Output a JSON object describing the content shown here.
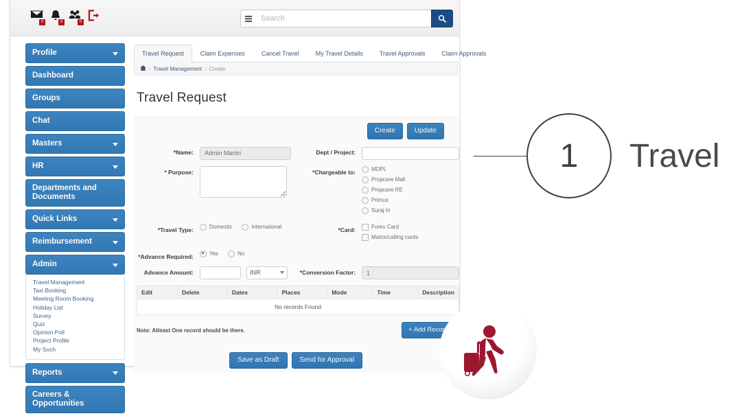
{
  "topbar": {
    "icons": [
      {
        "name": "mail-icon",
        "badge": "0"
      },
      {
        "name": "bell-icon",
        "badge": "0"
      },
      {
        "name": "users-icon",
        "badge": "0"
      },
      {
        "name": "logout-icon",
        "badge": ""
      }
    ],
    "search": {
      "placeholder": "Search",
      "value": "",
      "menu_icon": "hamburger-icon",
      "button_icon": "search-icon"
    }
  },
  "sidebar": {
    "items": [
      {
        "label": "Profile",
        "caret": true
      },
      {
        "label": "Dashboard",
        "caret": false
      },
      {
        "label": "Groups",
        "caret": false
      },
      {
        "label": "Chat",
        "caret": false
      },
      {
        "label": "Masters",
        "caret": true
      },
      {
        "label": "HR",
        "caret": true
      },
      {
        "label": "Departments and Documents",
        "caret": false
      },
      {
        "label": "Quick Links",
        "caret": true
      },
      {
        "label": "Reimbursement",
        "caret": true
      },
      {
        "label": "Admin",
        "caret": true
      }
    ],
    "admin_submenu": [
      "Travel Management",
      "Taxi Booking",
      "Meeting Room Booking",
      "Holiday List",
      "Survey",
      "Quiz",
      "Opinion Poll",
      "Project Profile",
      "My Soch"
    ],
    "items_after": [
      {
        "label": "Reports",
        "caret": true
      },
      {
        "label": "Careers & Opportunities",
        "caret": false
      }
    ]
  },
  "tabs": [
    {
      "label": "Travel Request",
      "active": true
    },
    {
      "label": "Claim Expenses",
      "active": false
    },
    {
      "label": "Cancel Travel",
      "active": false
    },
    {
      "label": "My Travel Details",
      "active": false
    },
    {
      "label": "Travel Approvals",
      "active": false
    },
    {
      "label": "Claim Approvals",
      "active": false
    }
  ],
  "breadcrumb": {
    "home_icon": "home-icon",
    "parent": "Travel Management",
    "current": "Create"
  },
  "page": {
    "title": "Travel Request"
  },
  "actions": {
    "create": "Create",
    "update": "Update",
    "add_record": "+ Add Record",
    "save_draft": "Save as Draft",
    "send_approval": "Send for Approval"
  },
  "form": {
    "name_label": "*Name:",
    "name_value": "Admin Mantri",
    "dept_label": "Dept / Project:",
    "dept_value": "",
    "purpose_label": "* Purpose:",
    "purpose_value": "",
    "chargeable_label": "*Chargeable to:",
    "chargeable_options": [
      {
        "label": "MDPL",
        "checked": false
      },
      {
        "label": "Propcare Mall",
        "checked": false
      },
      {
        "label": "Propcare RE",
        "checked": false
      },
      {
        "label": "Primus",
        "checked": false
      },
      {
        "label": "Suraj In",
        "checked": false
      }
    ],
    "travel_type_label": "*Travel Type:",
    "travel_type_options": [
      {
        "label": "Domestic",
        "checked": false
      },
      {
        "label": "International",
        "checked": false
      }
    ],
    "card_label": "*Card:",
    "card_options": [
      {
        "label": "Forex Card",
        "checked": false
      },
      {
        "label": "Matrix/calling cards",
        "checked": false
      }
    ],
    "advance_required_label": "*Advance Required:",
    "advance_required_options": [
      {
        "label": "Yes",
        "checked": true
      },
      {
        "label": "No",
        "checked": false
      }
    ],
    "advance_amount_label": "Advance Amount:",
    "advance_amount_value": "",
    "currency_value": "INR",
    "conversion_label": "*Conversion Factor:",
    "conversion_value": "1"
  },
  "table": {
    "headers": [
      "Edit",
      "Delete",
      "Dates",
      "Places",
      "Mode",
      "Time",
      "Description"
    ],
    "empty_text": "No records Found",
    "note": "Note: Atleast One record should be there."
  },
  "annotation": {
    "number": "1",
    "text": "Travel"
  },
  "badge_icon": {
    "name": "traveler-with-luggage-icon",
    "color": "#9d1730"
  }
}
